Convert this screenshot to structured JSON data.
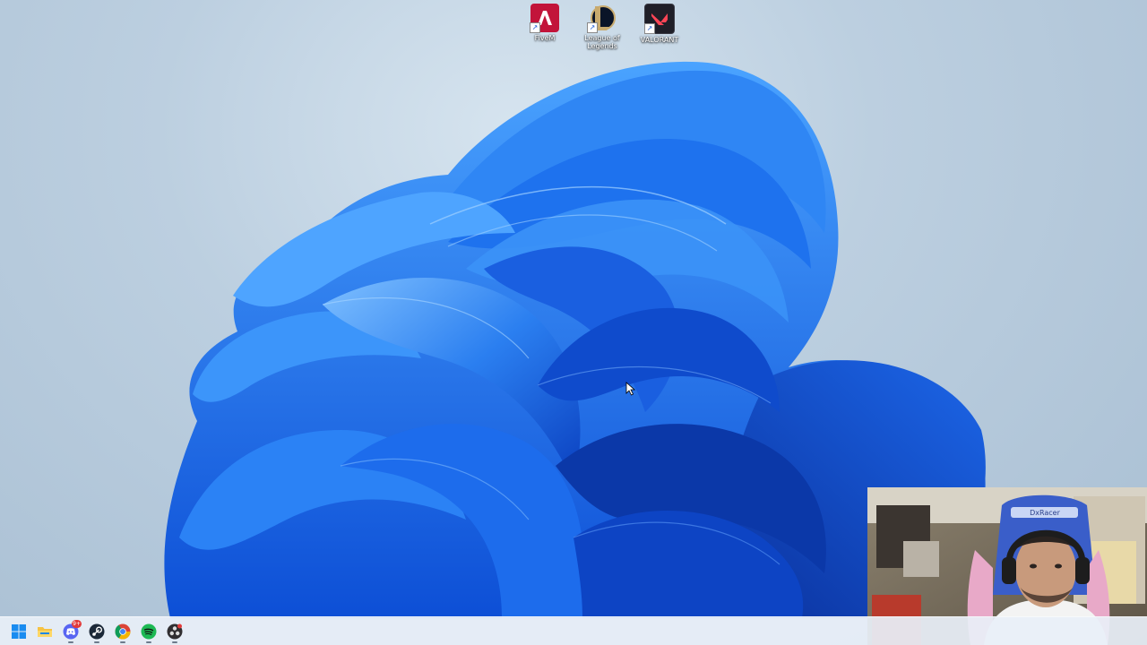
{
  "desktop": {
    "icons": [
      {
        "label": "FiveM",
        "icon": "fivem-icon",
        "color": "#c2143a"
      },
      {
        "label": "League of Legends",
        "icon": "league-of-legends-icon",
        "color": "#c8aa6e"
      },
      {
        "label": "VALORANT",
        "icon": "valorant-icon",
        "color": "#fd4556"
      }
    ]
  },
  "taskbar": {
    "items": [
      {
        "name": "start",
        "icon": "windows-logo-icon"
      },
      {
        "name": "file-explorer",
        "icon": "folder-icon"
      },
      {
        "name": "discord",
        "icon": "discord-icon",
        "badge": "9+"
      },
      {
        "name": "steam",
        "icon": "steam-icon"
      },
      {
        "name": "chrome",
        "icon": "chrome-icon"
      },
      {
        "name": "spotify",
        "icon": "spotify-icon"
      },
      {
        "name": "obs",
        "icon": "obs-icon"
      }
    ]
  },
  "webcam": {
    "chair_text": "DxRacer"
  },
  "colors": {
    "background": "#bccfe0",
    "bloom_blue": "#1a6bea",
    "taskbar": "#e8eff8"
  }
}
